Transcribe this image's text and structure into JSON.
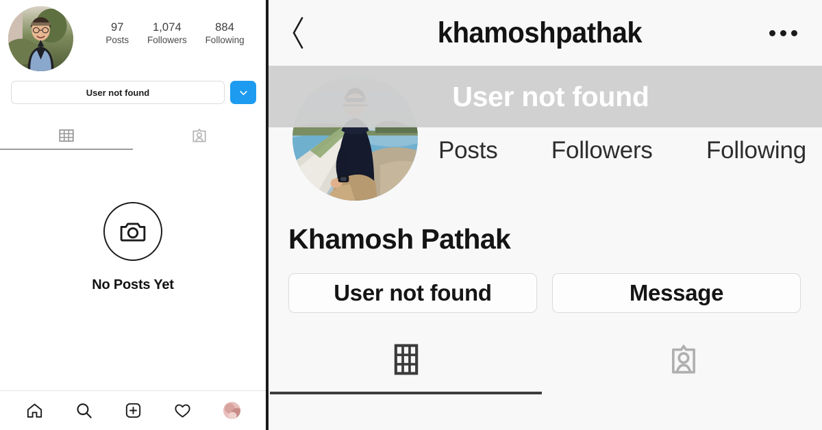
{
  "left_panel": {
    "avatar": "profile-photo-woman-smiling-outdoors",
    "stats": [
      {
        "value": "97",
        "label": "Posts"
      },
      {
        "value": "1,074",
        "label": "Followers"
      },
      {
        "value": "884",
        "label": "Following"
      }
    ],
    "primary_button": "User not found",
    "dropdown_icon": "chevron-down-icon",
    "dropdown_color": "#1C9BF0",
    "tabs": [
      {
        "icon": "grid-icon",
        "active": true
      },
      {
        "icon": "tagged-person-icon",
        "active": false
      }
    ],
    "empty_state": {
      "icon": "camera-in-circle-icon",
      "text": "No Posts Yet"
    },
    "bottom_nav": [
      {
        "icon": "home-icon"
      },
      {
        "icon": "search-icon"
      },
      {
        "icon": "new-post-plus-icon"
      },
      {
        "icon": "heart-icon"
      },
      {
        "icon": "profile-avatar-icon"
      }
    ]
  },
  "right_panel": {
    "header": {
      "back_icon": "chevron-left-icon",
      "username": "khamoshpathak",
      "more_icon": "ellipsis-icon"
    },
    "avatar": "profile-photo-man-sitting-by-water",
    "overlay_text": "User not found",
    "overlay_color": "#CDCDCD",
    "stats_labels": [
      "Posts",
      "Followers",
      "Following"
    ],
    "full_name": "Khamosh Pathak",
    "buttons": [
      "User not found",
      "Message"
    ],
    "tabs": [
      {
        "icon": "grid-icon",
        "active": true
      },
      {
        "icon": "tagged-person-icon",
        "active": false
      }
    ]
  }
}
